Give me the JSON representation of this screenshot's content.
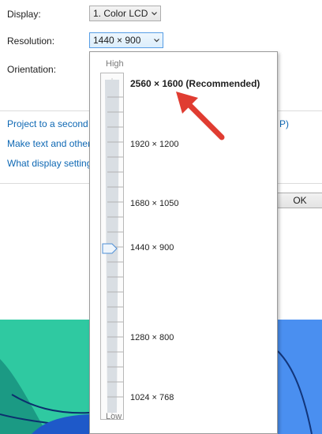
{
  "settings": {
    "display_label": "Display:",
    "display_value": "1. Color LCD",
    "resolution_label": "Resolution:",
    "resolution_value": "1440 × 900",
    "orientation_label": "Orientation:"
  },
  "links": {
    "project": "Project to a second",
    "make_text": "Make text and other",
    "what_display": "What display setting",
    "project_suffix": "P)"
  },
  "buttons": {
    "ok": "OK"
  },
  "resolution_popup": {
    "high_label": "High",
    "low_label": "Low",
    "options": [
      {
        "label": "2560 × 1600 (Recommended)",
        "recommended": true
      },
      {
        "label": "1920 × 1200"
      },
      {
        "label": "1680 × 1050"
      },
      {
        "label": "1440 × 900",
        "selected": true
      },
      {
        "label": "1280 × 800"
      },
      {
        "label": "1024 × 768"
      }
    ]
  },
  "colors": {
    "link": "#0e68b4",
    "arrow": "#e03c31",
    "combo_focus_border": "#569de5"
  }
}
